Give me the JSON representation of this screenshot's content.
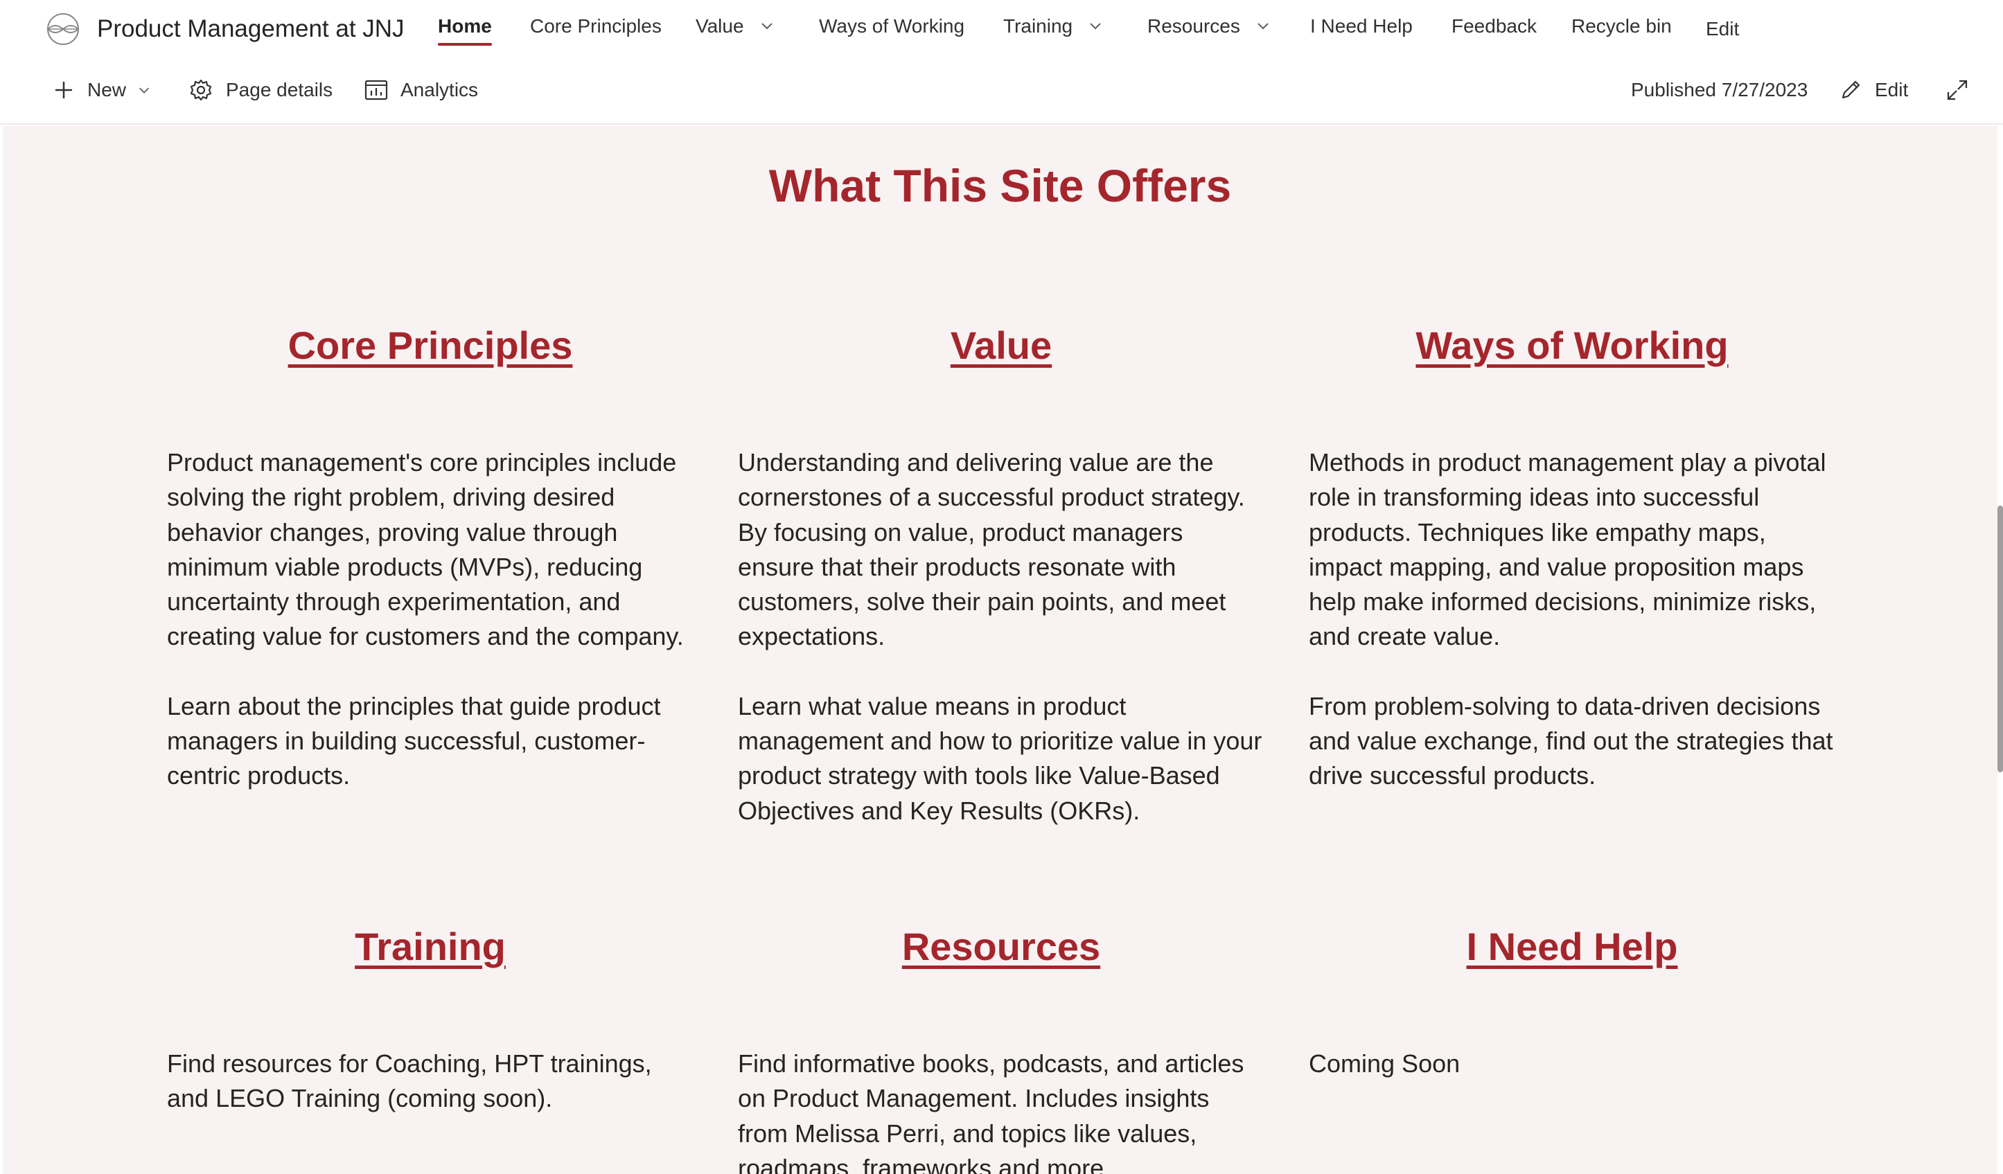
{
  "site": {
    "title": "Product Management at JNJ",
    "logo_icon": "site-logo-icon"
  },
  "nav": {
    "items": [
      {
        "label": "Home",
        "active": true
      },
      {
        "label": "Core Principles"
      },
      {
        "label": "Value",
        "dropdown": true
      },
      {
        "label": "Ways of Working"
      },
      {
        "label": "Training",
        "dropdown": true
      },
      {
        "label": "Resources",
        "dropdown": true
      },
      {
        "label": "I Need Help"
      },
      {
        "label": "Feedback"
      },
      {
        "label": "Recycle bin"
      },
      {
        "label": "Edit"
      }
    ]
  },
  "commandbar": {
    "new_label": "New",
    "page_details_label": "Page details",
    "analytics_label": "Analytics",
    "published_label": "Published 7/27/2023",
    "edit_label": "Edit"
  },
  "content": {
    "section_title": "What This Site Offers",
    "cards": [
      {
        "title": "Core Principles",
        "paragraphs": [
          "Product management's core principles include solving the right problem, driving desired behavior changes, proving value through minimum viable products (MVPs), reducing uncertainty through experimentation, and creating value for customers and the company.",
          "Learn about the principles that guide product managers in building successful, customer-centric products."
        ]
      },
      {
        "title": "Value",
        "paragraphs": [
          "Understanding and delivering value are the cornerstones of a successful product strategy. By focusing on value, product managers ensure that their products resonate with customers, solve their pain points, and meet expectations.",
          "Learn what value means in product management and how to prioritize value in your product strategy with tools like Value-Based Objectives and Key Results (OKRs)."
        ]
      },
      {
        "title": "Ways of Working",
        "paragraphs": [
          "Methods in product management play a pivotal role in transforming ideas into successful products. Techniques like empathy maps, impact mapping, and value proposition maps help make informed decisions, minimize risks, and create value.",
          "From problem-solving to data-driven decisions and value exchange, find out the strategies that drive successful products."
        ]
      },
      {
        "title": "Training",
        "paragraphs": [
          "Find resources for Coaching, HPT trainings, and LEGO Training (coming soon)."
        ]
      },
      {
        "title": "Resources",
        "paragraphs": [
          "Find informative books, podcasts, and articles on Product Management. Includes insights from Melissa Perri, and topics like values, roadmaps, frameworks and more."
        ]
      },
      {
        "title": "I Need Help",
        "paragraphs": [
          "Coming Soon"
        ]
      }
    ]
  },
  "colors": {
    "accent": "#a4262c",
    "page_bg": "#f8f2f2"
  }
}
